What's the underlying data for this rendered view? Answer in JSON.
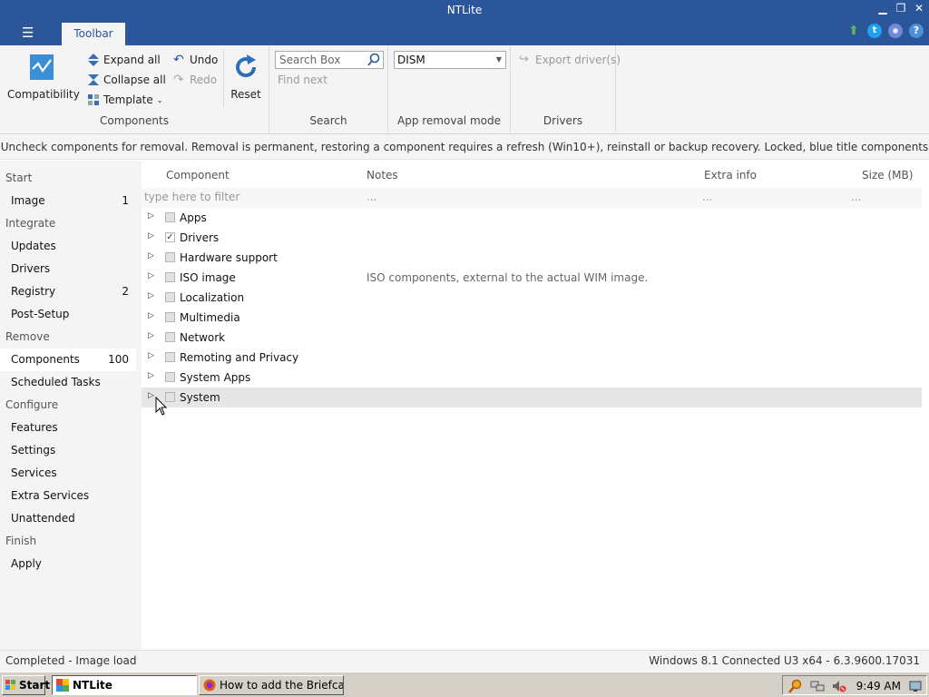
{
  "window": {
    "title": "NTLite",
    "menu_icon": "hamburger-icon",
    "tab_label": "Toolbar"
  },
  "window_controls": [
    "minimize-icon",
    "restore-icon",
    "close-icon"
  ],
  "social_icons": [
    "update-arrow-icon",
    "twitter-icon",
    "discord-icon",
    "help-icon"
  ],
  "ribbon": {
    "components": {
      "compatibility": "Compatibility",
      "expand_all": "Expand all",
      "collapse_all": "Collapse all",
      "template": "Template",
      "undo": "Undo",
      "redo": "Redo",
      "reset": "Reset",
      "group_label": "Components"
    },
    "search": {
      "placeholder": "Search Box",
      "find_next": "Find next",
      "group_label": "Search"
    },
    "app_removal": {
      "selected": "DISM",
      "group_label": "App removal mode"
    },
    "drivers": {
      "export": "Export driver(s)",
      "group_label": "Drivers"
    }
  },
  "info_text": "Uncheck components for removal. Removal is permanent, restoring a component requires a refresh (Win10+), reinstall or backup recovery. Locked, blue title components require a license.",
  "sidebar": {
    "sections": [
      {
        "title": "Start",
        "items": [
          {
            "label": "Image",
            "count": "1"
          }
        ]
      },
      {
        "title": "Integrate",
        "items": [
          {
            "label": "Updates",
            "count": ""
          },
          {
            "label": "Drivers",
            "count": ""
          },
          {
            "label": "Registry",
            "count": "2"
          },
          {
            "label": "Post-Setup",
            "count": ""
          }
        ]
      },
      {
        "title": "Remove",
        "items": [
          {
            "label": "Components",
            "count": "100"
          },
          {
            "label": "Scheduled Tasks",
            "count": ""
          }
        ]
      },
      {
        "title": "Configure",
        "items": [
          {
            "label": "Features",
            "count": ""
          },
          {
            "label": "Settings",
            "count": ""
          },
          {
            "label": "Services",
            "count": ""
          },
          {
            "label": "Extra Services",
            "count": ""
          },
          {
            "label": "Unattended",
            "count": ""
          }
        ]
      },
      {
        "title": "Finish",
        "items": [
          {
            "label": "Apply",
            "count": ""
          }
        ]
      }
    ]
  },
  "tree": {
    "columns": [
      "Component",
      "Notes",
      "Extra info",
      "Size (MB)"
    ],
    "filter_placeholder": "type here to filter",
    "filter_ellipsis": "...",
    "rows": [
      {
        "label": "Apps",
        "checked": false,
        "note": ""
      },
      {
        "label": "Drivers",
        "checked": true,
        "note": ""
      },
      {
        "label": "Hardware support",
        "checked": false,
        "note": ""
      },
      {
        "label": "ISO image",
        "checked": false,
        "note": "ISO components, external to the actual WIM image."
      },
      {
        "label": "Localization",
        "checked": false,
        "note": ""
      },
      {
        "label": "Multimedia",
        "checked": false,
        "note": ""
      },
      {
        "label": "Network",
        "checked": false,
        "note": ""
      },
      {
        "label": "Remoting and Privacy",
        "checked": false,
        "note": ""
      },
      {
        "label": "System Apps",
        "checked": false,
        "note": ""
      },
      {
        "label": "System",
        "checked": false,
        "note": ""
      }
    ]
  },
  "status": {
    "left": "Completed - Image load",
    "right": "Windows 8.1 Connected U3 x64 - 6.3.9600.17031"
  },
  "taskbar": {
    "start": "Start",
    "items": [
      {
        "label": "NTLite",
        "icon": "ntlite-icon",
        "active": true
      },
      {
        "label": "How to add the Briefca...",
        "icon": "firefox-icon",
        "active": false
      }
    ],
    "tray_icons": [
      "search-tray-icon",
      "network-tray-icon",
      "volume-muted-icon"
    ],
    "clock": "9:49 AM"
  },
  "colors": {
    "titlebar": "#2b579a",
    "accent": "#2b579a",
    "sidebar_bg": "#f4f4f4"
  }
}
